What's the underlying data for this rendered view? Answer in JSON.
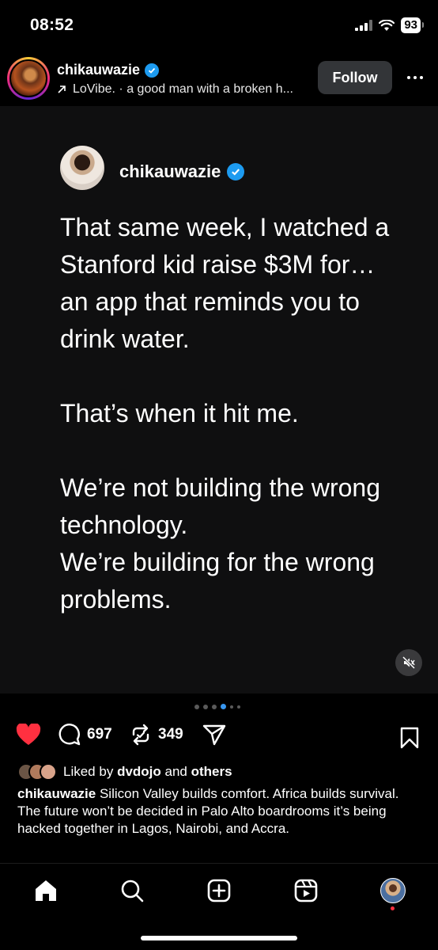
{
  "status_bar": {
    "time": "08:52",
    "battery": "93"
  },
  "header": {
    "username": "chikauwazie",
    "subtitle": "LoVibe. · a good man with a broken h...",
    "follow_label": "Follow"
  },
  "post": {
    "username": "chikauwazie",
    "paragraphs": [
      "That same week, I watched a Stanford kid raise $3M for… an app that reminds you to drink water.",
      "That’s when it hit me.",
      "We’re not building the wrong technology.\nWe’re building for the wrong problems."
    ],
    "carousel": {
      "total": 6,
      "active_index": 3
    }
  },
  "actions": {
    "comments": "697",
    "reposts": "349"
  },
  "liked_by": {
    "prefix": "Liked by",
    "user": "dvdojo",
    "and": "and",
    "others": "others"
  },
  "caption": {
    "username": "chikauwazie",
    "text": "Silicon Valley builds comfort. Africa builds survival. The future won’t be decided in Palo Alto boardrooms it’s being hacked together in Lagos, Nairobi, and Accra."
  },
  "icons": [
    "heart-icon",
    "comment-icon",
    "repost-icon",
    "share-icon",
    "bookmark-icon",
    "home-icon",
    "search-icon",
    "create-icon",
    "reels-icon",
    "mute-icon"
  ],
  "colors": {
    "like": "#ff3040",
    "verified": "#1d9bf0",
    "active_dot": "#3897f0"
  }
}
